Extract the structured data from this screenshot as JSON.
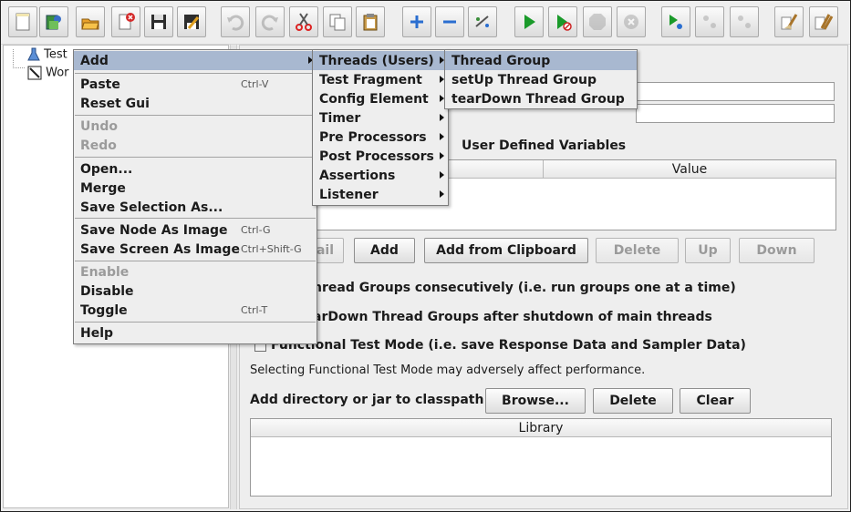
{
  "toolbar": {
    "buttons": [
      {
        "name": "new-icon",
        "label": "New"
      },
      {
        "name": "templates-icon",
        "label": "Templates"
      },
      {
        "name": "open-icon",
        "label": "Open"
      },
      {
        "name": "close-icon",
        "label": "Close"
      },
      {
        "name": "save-icon",
        "label": "Save"
      },
      {
        "name": "save-as-icon",
        "label": "Save As"
      },
      {
        "name": "undo-icon",
        "label": "Undo"
      },
      {
        "name": "redo-icon",
        "label": "Redo"
      },
      {
        "name": "cut-icon",
        "label": "Cut"
      },
      {
        "name": "copy-icon",
        "label": "Copy"
      },
      {
        "name": "paste-icon",
        "label": "Paste"
      },
      {
        "name": "expand-icon",
        "label": "Expand All"
      },
      {
        "name": "collapse-icon",
        "label": "Collapse All"
      },
      {
        "name": "toggle-icon",
        "label": "Toggle"
      },
      {
        "name": "start-icon",
        "label": "Start"
      },
      {
        "name": "start-no-pauses-icon",
        "label": "Start no pauses"
      },
      {
        "name": "stop-icon",
        "label": "Stop"
      },
      {
        "name": "shutdown-icon",
        "label": "Shutdown"
      },
      {
        "name": "remote-start-icon",
        "label": "Remote Start"
      },
      {
        "name": "remote-stop-icon",
        "label": "Remote Stop"
      },
      {
        "name": "remote-shutdown-icon",
        "label": "Remote Shutdown"
      },
      {
        "name": "clear-icon",
        "label": "Clear"
      },
      {
        "name": "clear-all-icon",
        "label": "Clear All"
      }
    ]
  },
  "tree": {
    "items": [
      "Test",
      "Wor"
    ]
  },
  "panel": {
    "udv_title": "User Defined Variables",
    "udv_columns": [
      "Value"
    ],
    "buttons": {
      "detail": "ail",
      "add": "Add",
      "add_clipboard": "Add from Clipboard",
      "delete": "Delete",
      "up": "Up",
      "down": "Down"
    },
    "options": {
      "consecutive": "hread Groups consecutively (i.e. run groups one at a time)",
      "teardown": "arDown Thread Groups after shutdown of main threads",
      "functional": "Functional Test Mode (i.e. save Response Data and Sampler Data)",
      "functional_note": "Selecting Functional Test Mode may adversely affect performance."
    },
    "classpath_label": "Add directory or jar to classpath",
    "classpath_buttons": {
      "browse": "Browse...",
      "delete": "Delete",
      "clear": "Clear"
    },
    "library_column": "Library"
  },
  "context_menu": {
    "items": [
      {
        "label": "Add",
        "shortcut": "",
        "submenu": true,
        "state": "selected"
      },
      {
        "label": "Paste",
        "shortcut": "Ctrl-V",
        "state": "enabled"
      },
      {
        "label": "Reset Gui",
        "shortcut": "",
        "state": "enabled"
      },
      {
        "label": "Undo",
        "shortcut": "",
        "state": "disabled"
      },
      {
        "label": "Redo",
        "shortcut": "",
        "state": "disabled"
      },
      {
        "label": "Open...",
        "shortcut": "",
        "state": "enabled"
      },
      {
        "label": "Merge",
        "shortcut": "",
        "state": "enabled"
      },
      {
        "label": "Save Selection As...",
        "shortcut": "",
        "state": "enabled"
      },
      {
        "label": "Save Node As Image",
        "shortcut": "Ctrl-G",
        "state": "enabled"
      },
      {
        "label": "Save Screen As Image",
        "shortcut": "Ctrl+Shift-G",
        "state": "enabled"
      },
      {
        "label": "Enable",
        "shortcut": "",
        "state": "disabled"
      },
      {
        "label": "Disable",
        "shortcut": "",
        "state": "enabled"
      },
      {
        "label": "Toggle",
        "shortcut": "Ctrl-T",
        "state": "enabled"
      },
      {
        "label": "Help",
        "shortcut": "",
        "state": "enabled"
      }
    ]
  },
  "add_submenu": {
    "items": [
      {
        "label": "Threads (Users)",
        "submenu": true,
        "state": "selected"
      },
      {
        "label": "Test Fragment",
        "submenu": true
      },
      {
        "label": "Config Element",
        "submenu": true
      },
      {
        "label": "Timer",
        "submenu": true
      },
      {
        "label": "Pre Processors",
        "submenu": true
      },
      {
        "label": "Post Processors",
        "submenu": true
      },
      {
        "label": "Assertions",
        "submenu": true
      },
      {
        "label": "Listener",
        "submenu": true
      }
    ]
  },
  "threads_submenu": {
    "items": [
      {
        "label": "Thread Group",
        "state": "selected"
      },
      {
        "label": "setUp Thread Group"
      },
      {
        "label": "tearDown Thread Group"
      }
    ]
  },
  "colors": {
    "menu_highlight": "#a8b8d0",
    "background": "#eeeeee",
    "run_green": "#1a9a2a"
  }
}
